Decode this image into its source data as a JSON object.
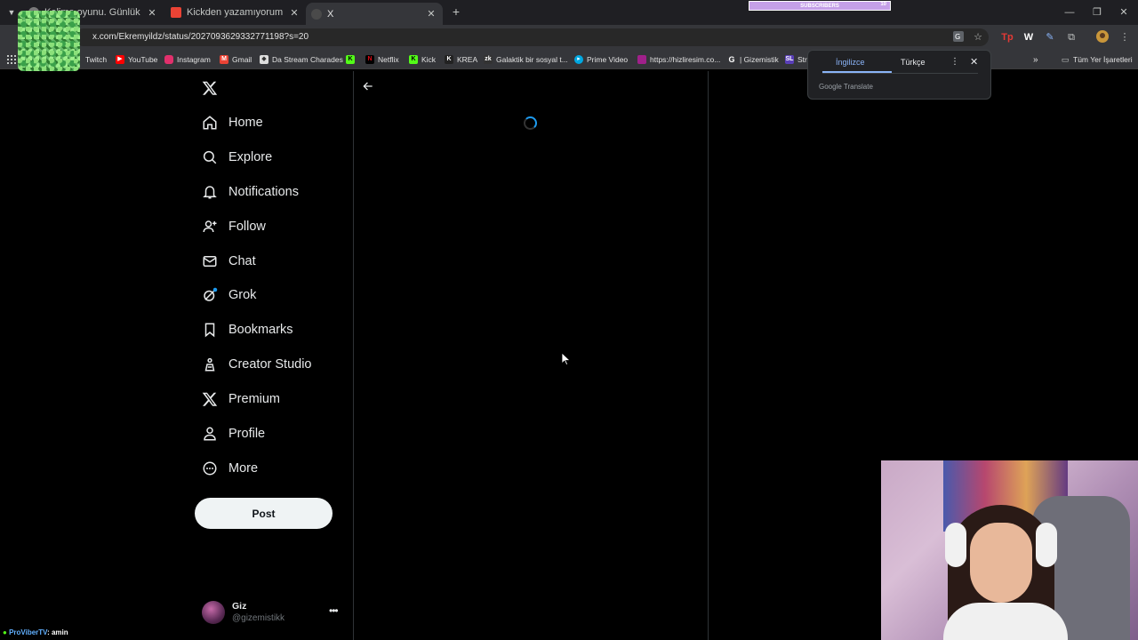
{
  "browser": {
    "tabs": [
      {
        "title": "Kelime oyunu. Günlük",
        "active": false
      },
      {
        "title": "Kickden yazamıyorum bot sanı",
        "active": false
      },
      {
        "title": "X",
        "active": true
      }
    ],
    "url": "x.com/Ekremyildz/status/2027093629332771198?s=20",
    "bookmarks": [
      {
        "label": "Twitch",
        "icon_color": "#9146ff"
      },
      {
        "label": "YouTube",
        "icon_color": "#ff0000"
      },
      {
        "label": "Instagram",
        "icon_color": "#e1306c"
      },
      {
        "label": "Gmail",
        "icon_color": "#ea4335"
      },
      {
        "label": "Da Stream Charades",
        "icon_color": "#cccccc"
      },
      {
        "label": "",
        "icon_color": "#53fc18",
        "icon_text": "K"
      },
      {
        "label": "Netflix",
        "icon_color": "#e50914"
      },
      {
        "label": "Kick",
        "icon_color": "#53fc18",
        "icon_text": "K"
      },
      {
        "label": "KREA",
        "icon_color": "#222222",
        "icon_text": "K"
      },
      {
        "label": "Galaktik bir sosyal t...",
        "icon_color": "#333333",
        "icon_text": "zk"
      },
      {
        "label": "Prime Video",
        "icon_color": "#00a8e1"
      },
      {
        "label": "https://hizliresim.co...",
        "icon_color": "#a0208a"
      },
      {
        "label": "| Gizemistik",
        "icon_color": "#444444",
        "icon_text": "G"
      },
      {
        "label": "Str",
        "icon_color": "#5a3fb8",
        "icon_text": "SL"
      }
    ],
    "bookmarks_overflow": "»",
    "bookmarks_folder": "Tüm Yer İşaretleri",
    "subs_widget": {
      "label": "SUBSCRIBERS",
      "count": "10"
    }
  },
  "translate_popup": {
    "tab_source": "İngilizce",
    "tab_target": "Türkçe",
    "brand": "Google Translate"
  },
  "x": {
    "nav": [
      {
        "label": "Home",
        "icon": "home-icon"
      },
      {
        "label": "Explore",
        "icon": "search-icon"
      },
      {
        "label": "Notifications",
        "icon": "bell-icon"
      },
      {
        "label": "Follow",
        "icon": "follow-icon"
      },
      {
        "label": "Chat",
        "icon": "mail-icon"
      },
      {
        "label": "Grok",
        "icon": "grok-icon"
      },
      {
        "label": "Bookmarks",
        "icon": "bookmark-icon"
      },
      {
        "label": "Creator Studio",
        "icon": "creator-studio-icon"
      },
      {
        "label": "Premium",
        "icon": "x-logo-icon"
      },
      {
        "label": "Profile",
        "icon": "person-icon"
      },
      {
        "label": "More",
        "icon": "more-circle-icon"
      }
    ],
    "post_button": "Post",
    "account": {
      "name": "Giz",
      "handle": "@gizemistikk"
    }
  },
  "stream_chat": {
    "user": "ProViberTV",
    "message": ": amin"
  },
  "colors": {
    "accent": "#1d9bf0",
    "background": "#000000",
    "divider": "#2f3336"
  }
}
